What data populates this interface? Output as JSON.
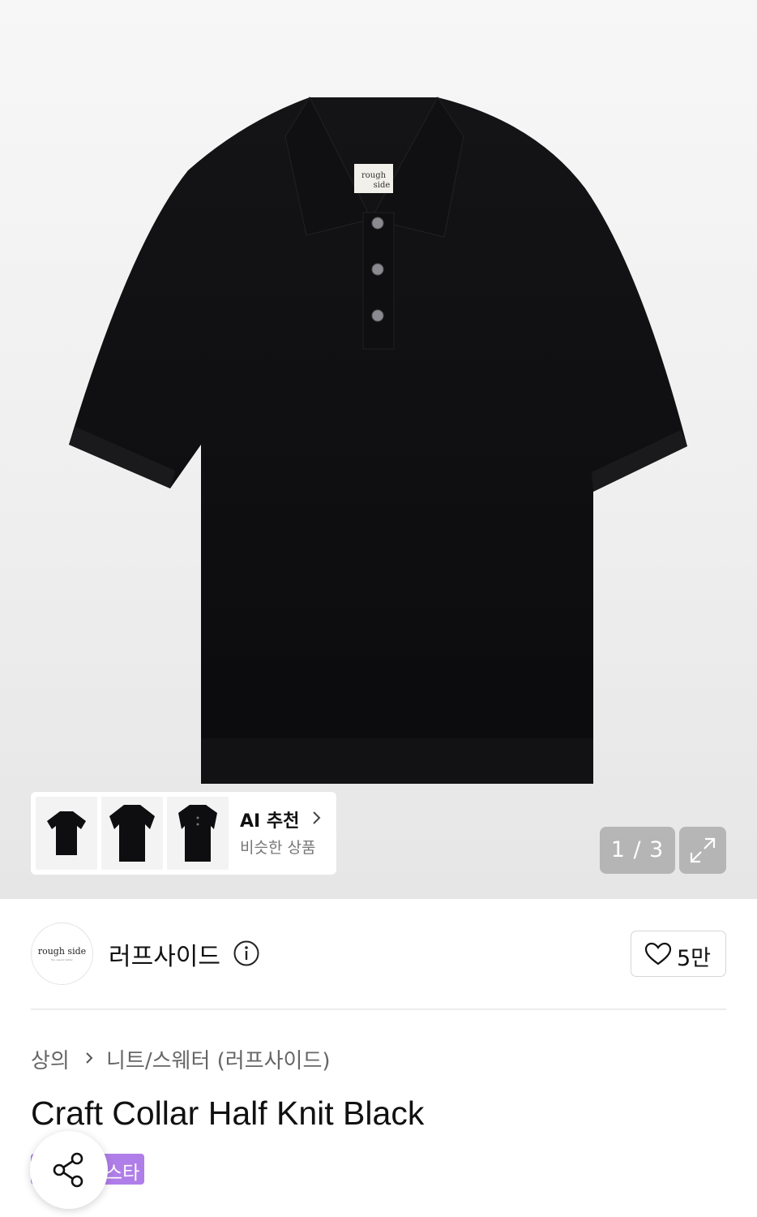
{
  "gallery": {
    "page_indicator": "1 / 3",
    "expand_icon": "expand-diagonal-icon",
    "ai_recommend": {
      "title": "AI 추천",
      "subtitle": "비슷한 상품"
    },
    "product_label_top": "rough",
    "product_label_bottom": "side"
  },
  "brand": {
    "name": "러프사이드",
    "logo_text": "rough side",
    "logo_subtext": "the casual matter",
    "like_count": "5만"
  },
  "breadcrumb": {
    "category": "상의",
    "subcategory": "니트/스웨터 (러프사이드)"
  },
  "product": {
    "title": "Craft Collar Half Knit Black",
    "badge": "스타"
  },
  "colors": {
    "badge": "#b07ee8",
    "shirt": "#0d0d0f"
  }
}
